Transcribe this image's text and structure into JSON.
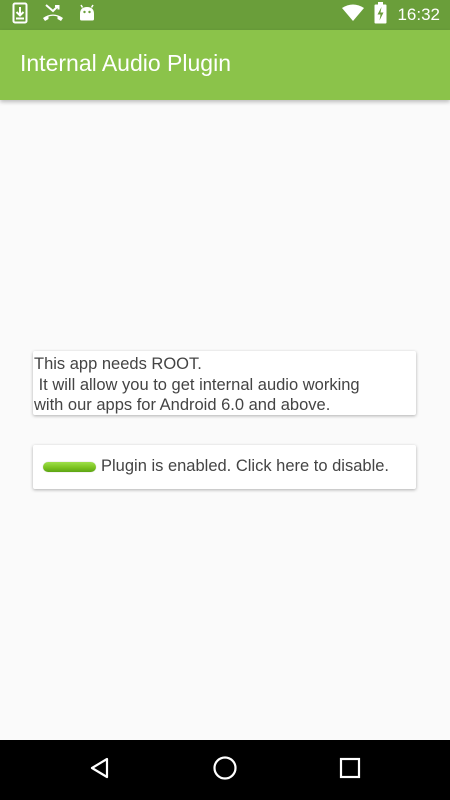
{
  "status_bar": {
    "time": "16:32",
    "left_icons": [
      "download-icon",
      "missed-call-icon",
      "android-icon"
    ],
    "right_icons": [
      "wifi-icon",
      "battery-charging-icon"
    ]
  },
  "app_bar": {
    "title": "Internal Audio Plugin",
    "color": "#8bc34a"
  },
  "info_card": {
    "lines": [
      "This app needs ROOT.",
      " It will allow you to get internal audio working",
      "with our apps for Android 6.0 and above."
    ]
  },
  "plugin_toggle": {
    "label": "Plugin is enabled. Click here to disable.",
    "state": "enabled",
    "indicator_color": "#7cc321"
  },
  "nav_bar": {
    "buttons": [
      "back-icon",
      "home-icon",
      "recents-icon"
    ]
  }
}
